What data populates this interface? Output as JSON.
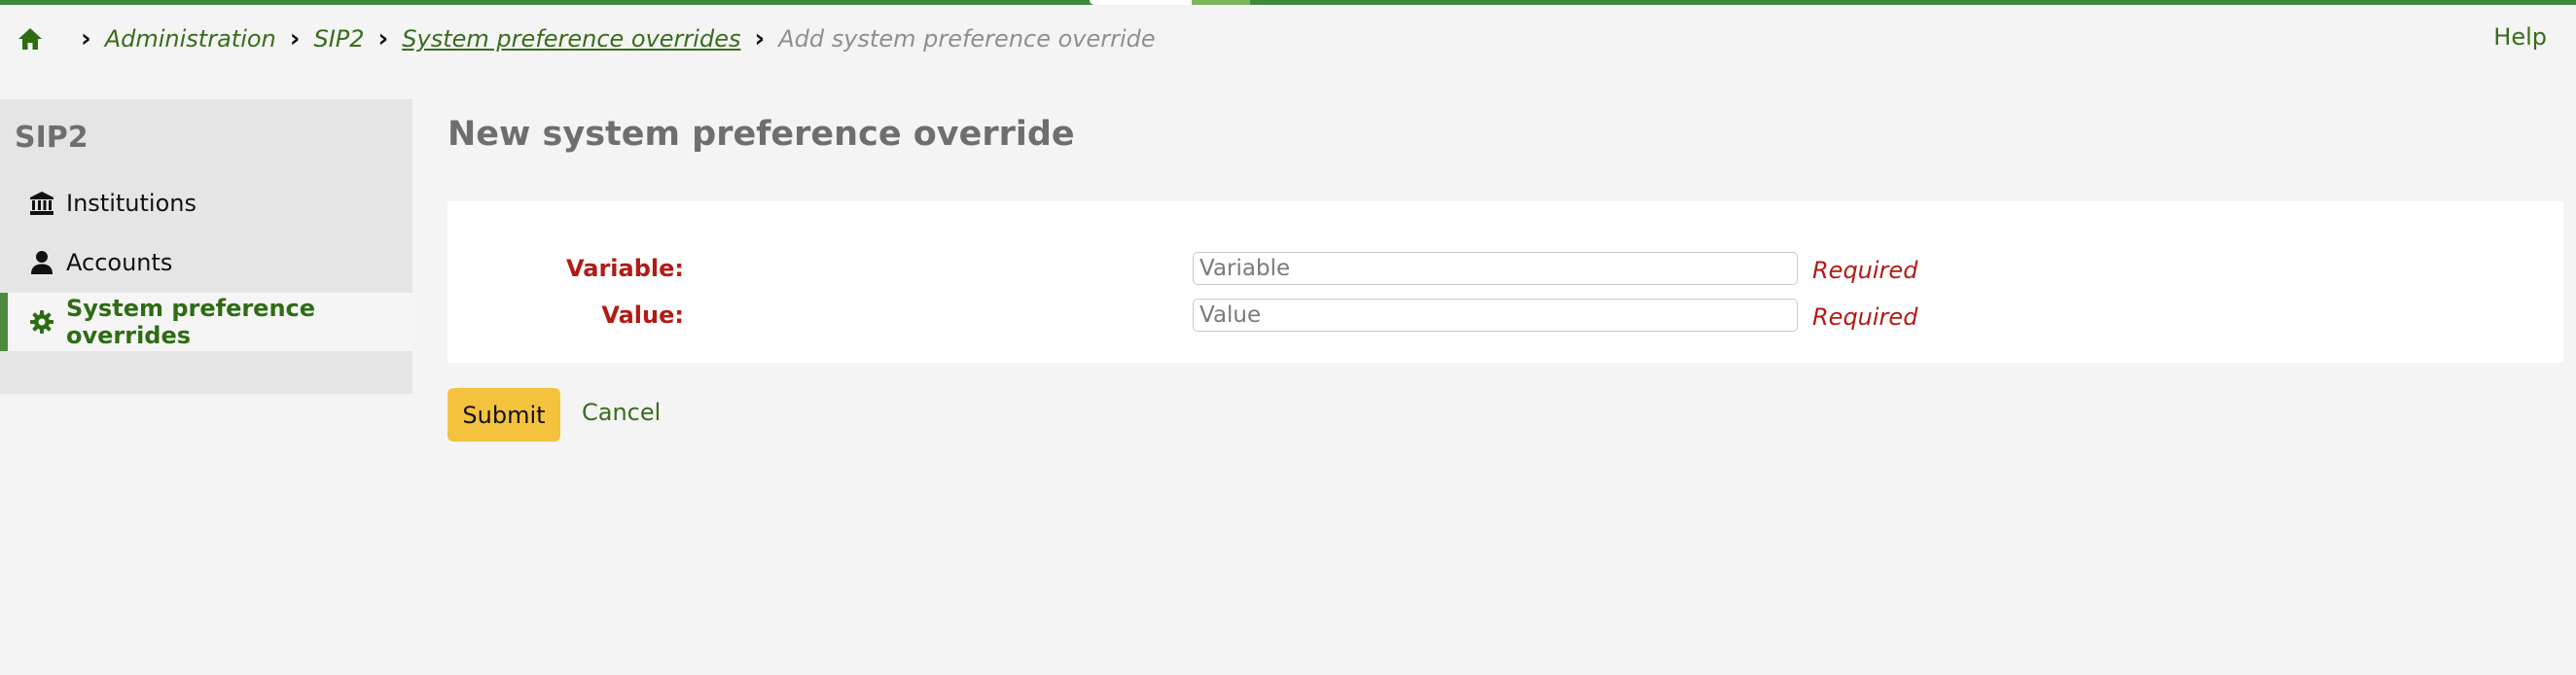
{
  "breadcrumb": {
    "home_icon": "home-icon",
    "items": [
      {
        "label": "Administration"
      },
      {
        "label": "SIP2"
      },
      {
        "label": "System preference overrides"
      }
    ],
    "current": "Add system preference override",
    "separator": "›"
  },
  "header": {
    "help_label": "Help"
  },
  "sidebar": {
    "title": "SIP2",
    "items": [
      {
        "label": "Institutions",
        "icon": "building-columns-icon"
      },
      {
        "label": "Accounts",
        "icon": "user-icon"
      },
      {
        "label": "System preference overrides",
        "icon": "gear-icon",
        "active": true
      }
    ]
  },
  "main": {
    "title": "New system preference override",
    "form": {
      "variable": {
        "label": "Variable:",
        "placeholder": "Variable",
        "value": "",
        "required_text": "Required"
      },
      "value": {
        "label": "Value:",
        "placeholder": "Value",
        "value": "",
        "required_text": "Required"
      }
    },
    "submit_label": "Submit",
    "cancel_label": "Cancel"
  },
  "colors": {
    "accent_green": "#3a6c1c",
    "progress_green": "#3f8a3a",
    "required_red": "#b21b15",
    "submit_yellow": "#f5c23e"
  }
}
